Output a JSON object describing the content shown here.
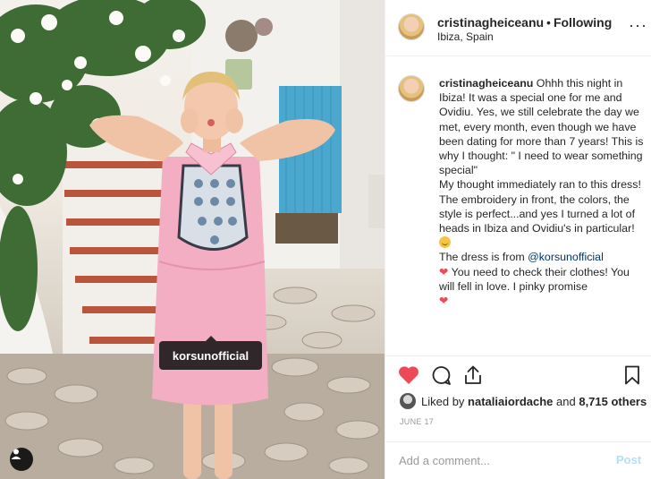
{
  "colors": {
    "accent": "#3897f0",
    "like_red": "#ed4956",
    "post_disabled": "#b2dffc",
    "muted": "#999999",
    "link": "#003569"
  },
  "photo": {
    "tag_label": "korsunofficial",
    "user_tag_icon": "user-icon"
  },
  "header": {
    "username": "cristinagheiceanu",
    "separator": "•",
    "follow_status": "Following",
    "location": "Ibiza, Spain",
    "more_icon": "more-options-icon",
    "more_label": "···"
  },
  "caption": {
    "username": "cristinagheiceanu",
    "text_part1": " Ohhh this night in Ibiza! It was a special one for me and Ovidiu. Yes, we still celebrate the day we met, every month, even though we have been dating for more than 7 years! This is why I thought: \" I need to wear something special\"\nMy thought immediately ran to this dress!\nThe embroidery in front, the colors, the style is perfect...and yes I turned a lot of heads in Ibiza and Ovidiu's in particular! ",
    "text_part2": "\nThe dress is from ",
    "mention": "@korsunofficial",
    "text_part3": " You need to check their clothes! You will fell in love. I pinky promise",
    "heart": "❤",
    "emoji_icon": "grinning-face-icon"
  },
  "actions": {
    "like_icon": "heart-icon",
    "comment_icon": "comment-icon",
    "share_icon": "share-icon",
    "save_icon": "bookmark-icon"
  },
  "likes": {
    "prefix": "Liked by ",
    "user": "nataliaiordache",
    "middle": " and ",
    "others": "8,715 others"
  },
  "date": "JUNE 17",
  "comment": {
    "placeholder": "Add a comment...",
    "post_label": "Post"
  }
}
